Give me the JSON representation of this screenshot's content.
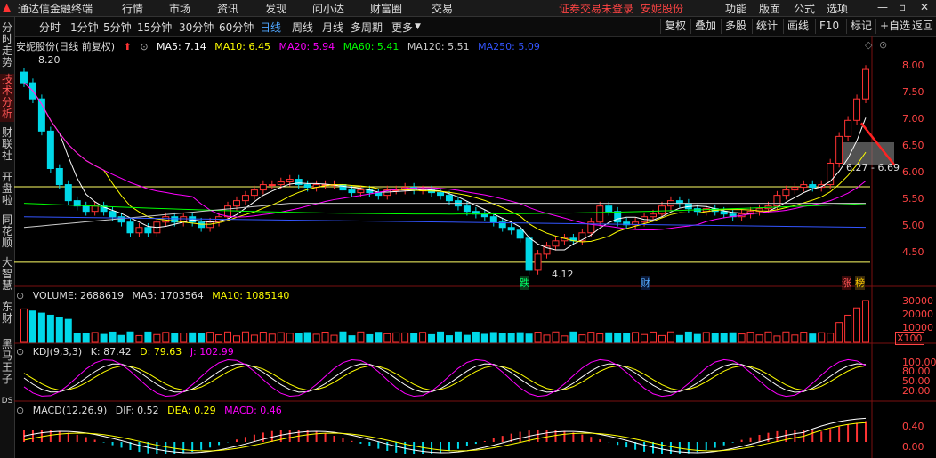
{
  "menubar": {
    "title": "通达信金融终端",
    "menus": [
      "行情",
      "市场",
      "资讯",
      "发现",
      "问小达",
      "财富圈",
      "交易"
    ],
    "login_status": "证券交易未登录",
    "stock_name": "安妮股份",
    "right_menus": [
      "功能",
      "版面",
      "公式",
      "选项"
    ]
  },
  "toolbar": {
    "periods": [
      "分时",
      "1分钟",
      "5分钟",
      "15分钟",
      "30分钟",
      "60分钟",
      "日线",
      "周线",
      "月线",
      "多周期",
      "更多"
    ],
    "active_period": "日线",
    "right_buttons": [
      "复权",
      "叠加",
      "多股",
      "统计",
      "画线",
      "F10",
      "标记",
      "+自选",
      "返回"
    ]
  },
  "sidebar": {
    "items": [
      "分时走势",
      "技术分析",
      "财联社",
      "开盘啦",
      "同花顺",
      "大智慧",
      "东财",
      "黑马王子",
      "DS"
    ]
  },
  "price_panel": {
    "title": "安妮股份(日线 前复权)",
    "ma": [
      {
        "label": "MA5: 7.14",
        "color": "#ffffff"
      },
      {
        "label": "MA10: 6.45",
        "color": "#ffff00"
      },
      {
        "label": "MA20: 5.94",
        "color": "#ff00ff"
      },
      {
        "label": "MA60: 5.41",
        "color": "#00ff00"
      },
      {
        "label": "MA120: 5.51",
        "color": "#cccccc"
      },
      {
        "label": "MA250: 5.09",
        "color": "#3333ff"
      }
    ],
    "y_ticks": [
      "8.00",
      "7.50",
      "7.00",
      "6.50",
      "6.00",
      "5.50",
      "5.00",
      "4.50"
    ],
    "high_label": "8.20",
    "low_label": "4.12",
    "zone_label": "6.27 - 6.69",
    "markers": {
      "die": "跌",
      "cai": "财",
      "zhang": "涨",
      "bang": "榜"
    }
  },
  "volume_panel": {
    "title": "VOLUME: 2688619",
    "ma5": "MA5: 1703564",
    "ma10": "MA10: 1085140",
    "y_ticks": [
      "30000",
      "20000",
      "10000"
    ],
    "unit": "X100"
  },
  "kdj_panel": {
    "title": "KDJ(9,3,3)",
    "k": "K: 87.42",
    "d": "D: 79.63",
    "j": "J: 102.99",
    "y_ticks": [
      "100.00",
      "80.00",
      "50.00",
      "20.00"
    ]
  },
  "macd_panel": {
    "title": "MACD(12,26,9)",
    "dif": "DIF: 0.52",
    "dea": "DEA: 0.29",
    "macd": "MACD: 0.46",
    "y_ticks": [
      "0.40",
      "0.00"
    ]
  },
  "chart_data": {
    "type": "candlestick",
    "title": "安妮股份(日线 前复权)",
    "ylim": [
      4.12,
      8.2
    ],
    "y_ticks": [
      8.0,
      7.5,
      7.0,
      6.5,
      6.0,
      5.5,
      5.0,
      4.5
    ],
    "annotations": {
      "high": 8.2,
      "low": 4.12,
      "zone": [
        6.27,
        6.69
      ]
    },
    "closes": [
      7.8,
      7.5,
      6.9,
      6.2,
      5.9,
      5.6,
      5.5,
      5.4,
      5.5,
      5.4,
      5.3,
      5.2,
      5.0,
      5.1,
      5.0,
      5.2,
      5.3,
      5.2,
      5.3,
      5.2,
      5.1,
      5.2,
      5.3,
      5.5,
      5.6,
      5.7,
      5.8,
      5.9,
      5.9,
      5.95,
      6.0,
      5.9,
      5.85,
      5.9,
      5.9,
      5.9,
      5.8,
      5.75,
      5.8,
      5.75,
      5.7,
      5.8,
      5.8,
      5.85,
      5.8,
      5.8,
      5.75,
      5.7,
      5.6,
      5.5,
      5.4,
      5.35,
      5.3,
      5.2,
      5.1,
      5.05,
      4.9,
      4.3,
      4.6,
      4.75,
      4.85,
      4.9,
      4.85,
      5.0,
      5.2,
      5.5,
      5.4,
      5.2,
      5.15,
      5.2,
      5.3,
      5.35,
      5.5,
      5.6,
      5.55,
      5.45,
      5.4,
      5.45,
      5.4,
      5.35,
      5.3,
      5.35,
      5.4,
      5.45,
      5.5,
      5.7,
      5.8,
      5.85,
      5.9,
      5.85,
      5.9,
      6.3,
      6.8,
      7.1,
      7.5,
      8.05
    ],
    "volume_ticks": [
      30000,
      20000,
      10000
    ],
    "kdj": {
      "K": 87.42,
      "D": 79.63,
      "J": 102.99
    },
    "macd": {
      "DIF": 0.52,
      "DEA": 0.29,
      "MACD": 0.46
    }
  }
}
